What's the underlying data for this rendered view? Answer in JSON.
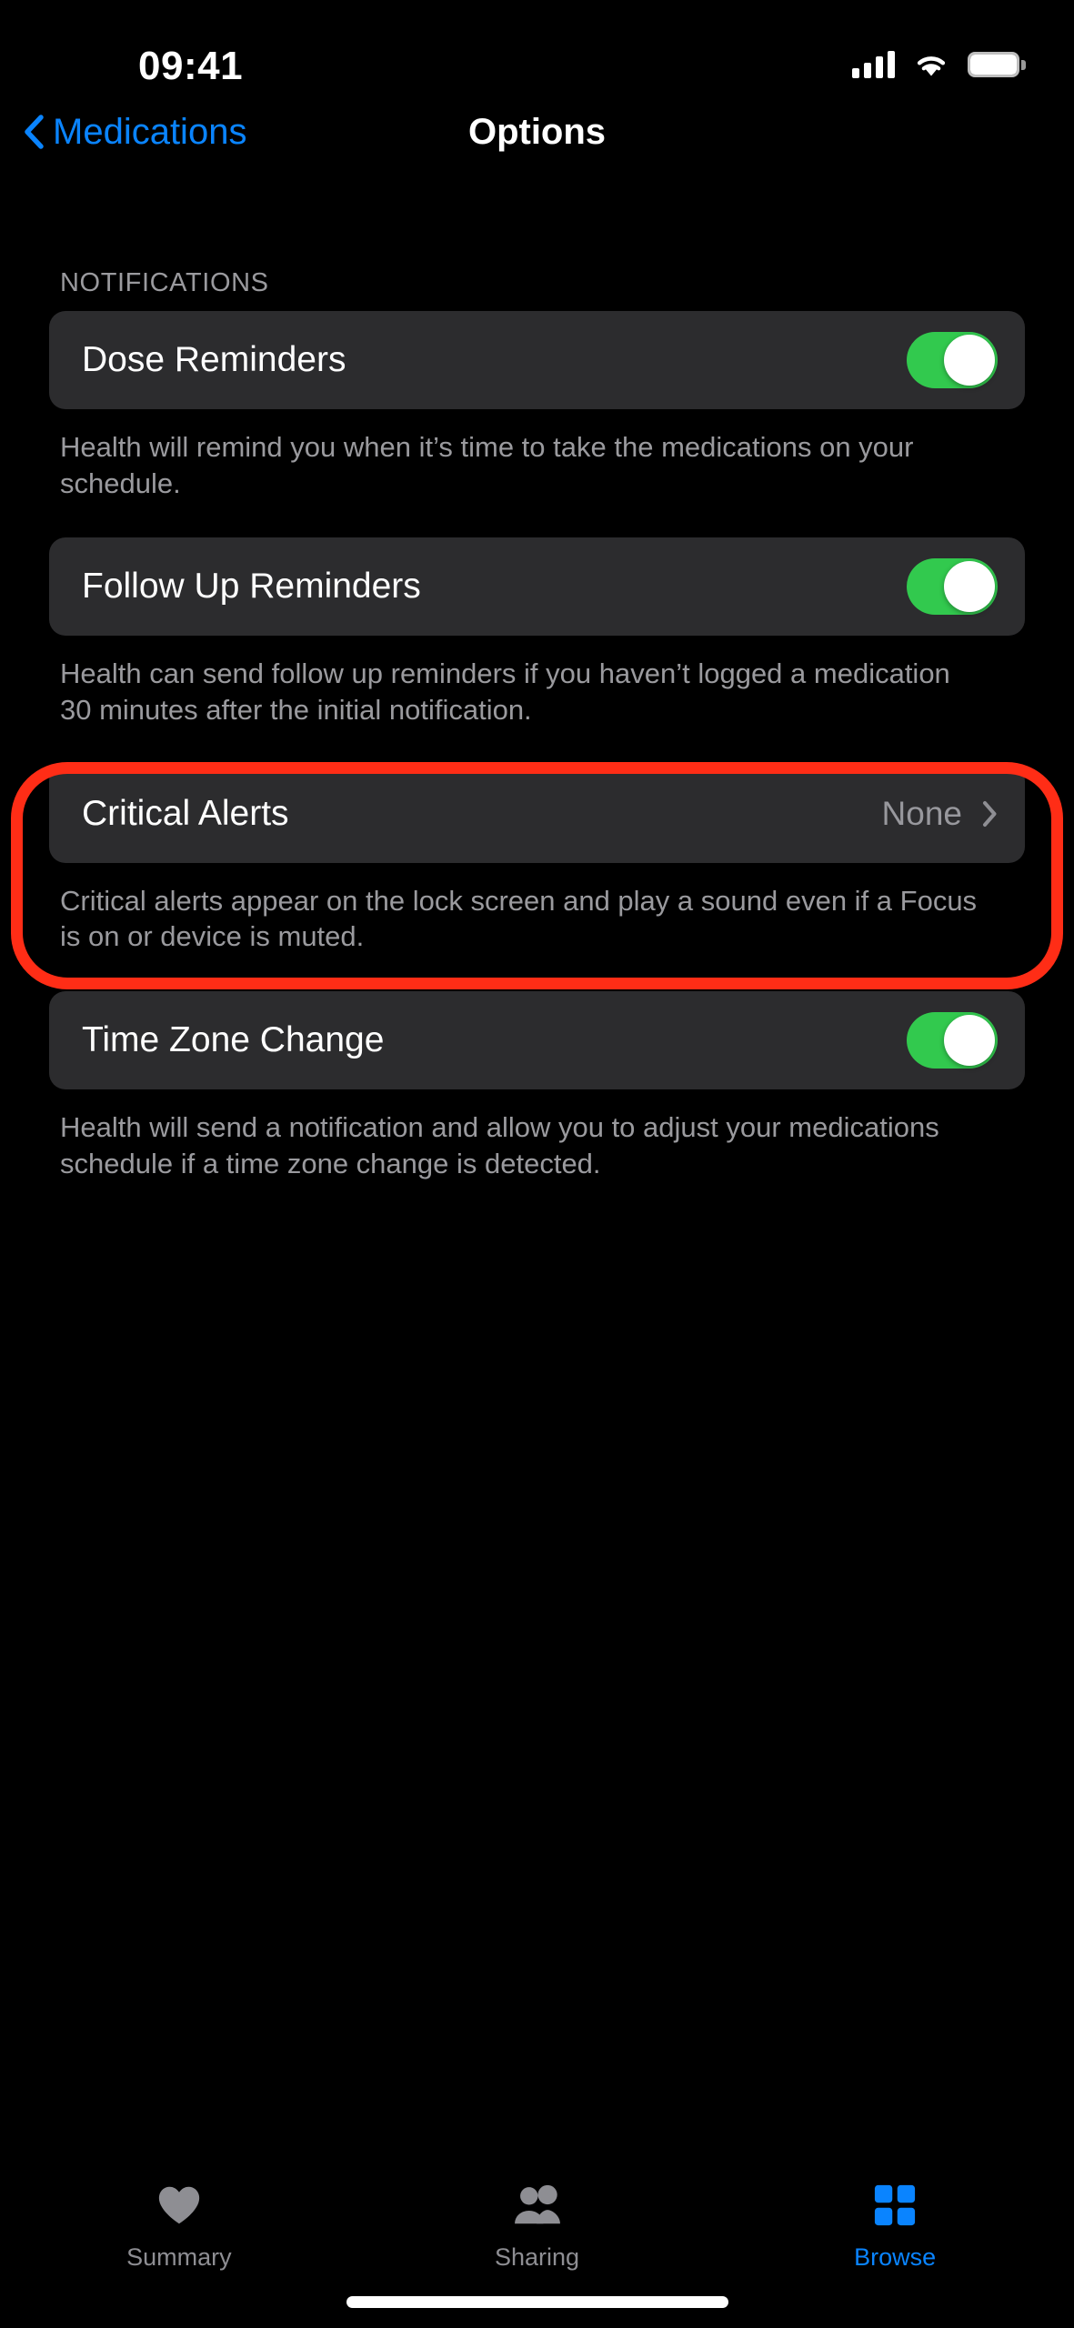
{
  "status_bar": {
    "time": "09:41",
    "cellular_icon": "signal-bars-icon",
    "wifi_icon": "wifi-icon",
    "battery_icon": "battery-full-icon"
  },
  "nav": {
    "back_label": "Medications",
    "back_icon": "chevron-left-icon",
    "title": "Options"
  },
  "section": {
    "header": "NOTIFICATIONS"
  },
  "rows": [
    {
      "label": "Dose Reminders",
      "control": "toggle",
      "toggle_on": true,
      "footnote": "Health will remind you when it’s time to take the medications on your schedule."
    },
    {
      "label": "Follow Up Reminders",
      "control": "toggle",
      "toggle_on": true,
      "footnote": "Health can send follow up reminders if you haven’t logged a medication 30 minutes after the initial notification."
    },
    {
      "label": "Critical Alerts",
      "control": "disclosure",
      "value": "None",
      "disclosure_icon": "chevron-right-icon",
      "footnote": "Critical alerts appear on the lock screen and play a sound even if a Focus is on or device is muted.",
      "highlighted": true
    },
    {
      "label": "Time Zone Change",
      "control": "toggle",
      "toggle_on": true,
      "footnote": "Health will send a notification and allow you to adjust your medications schedule if a time zone change is detected."
    }
  ],
  "tabbar": {
    "items": [
      {
        "label": "Summary",
        "icon": "heart-icon",
        "active": false
      },
      {
        "label": "Sharing",
        "icon": "people-icon",
        "active": false
      },
      {
        "label": "Browse",
        "icon": "grid-icon",
        "active": true
      }
    ]
  },
  "colors": {
    "accent_blue": "#0a84ff",
    "toggle_green": "#32c94e",
    "annotation_red": "#ff2d16",
    "row_background": "#2c2c2e",
    "secondary_text": "#9a9a9e",
    "page_background": "#000000"
  }
}
